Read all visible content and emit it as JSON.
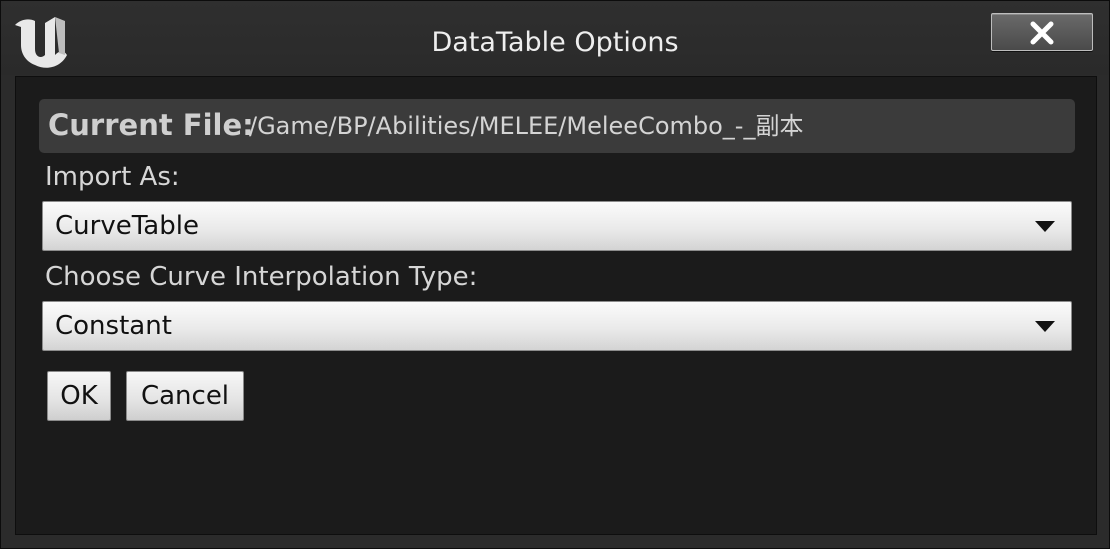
{
  "window": {
    "title": "DataTable Options",
    "logo_icon": "unreal-engine-logo-icon",
    "close_icon": "close-x-icon"
  },
  "current_file": {
    "label": "Current File:",
    "path": "/Game/BP/Abilities/MELEE/MeleeCombo_-_副本"
  },
  "import_as": {
    "label": "Import As:",
    "selected": "CurveTable"
  },
  "interpolation": {
    "label": "Choose Curve Interpolation Type:",
    "selected": "Constant"
  },
  "buttons": {
    "ok": "OK",
    "cancel": "Cancel"
  },
  "colors": {
    "title_bar": "#2b2b2b",
    "content_bg": "#1b1b1b",
    "file_bar": "#3b3b3b",
    "text": "#d6d6d6"
  }
}
